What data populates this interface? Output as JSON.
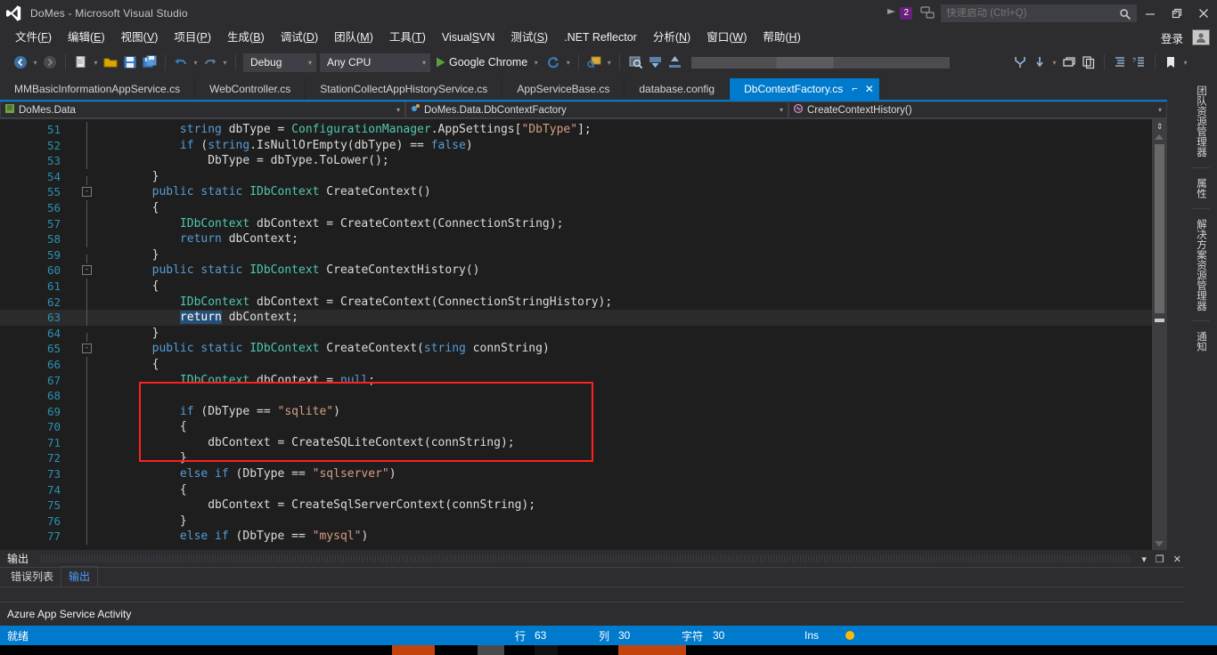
{
  "window": {
    "title": "DoMes - Microsoft Visual Studio",
    "logo_icon": "visual-studio-logo",
    "minimize_icon": "minimize-icon",
    "maximize_icon": "restore-icon",
    "close_icon": "close-icon",
    "notification_count": "2",
    "quick_launch_placeholder": "快速启动 (Ctrl+Q)",
    "quick_launch_value": "",
    "search_icon": "search-icon",
    "sign_in_label": "登录",
    "account_icon": "account-icon",
    "feedback_icon": "feedback-icon",
    "flag_icon": "flag-icon"
  },
  "menu": {
    "items": [
      {
        "pre": "文件(",
        "key": "F",
        "post": ")"
      },
      {
        "pre": "编辑(",
        "key": "E",
        "post": ")"
      },
      {
        "pre": "视图(",
        "key": "V",
        "post": ")"
      },
      {
        "pre": "项目(",
        "key": "P",
        "post": ")"
      },
      {
        "pre": "生成(",
        "key": "B",
        "post": ")"
      },
      {
        "pre": "调试(",
        "key": "D",
        "post": ")"
      },
      {
        "pre": "团队(",
        "key": "M",
        "post": ")"
      },
      {
        "pre": "工具(",
        "key": "T",
        "post": ")"
      },
      {
        "pre": "Visual",
        "key": "S",
        "post": "VN"
      },
      {
        "pre": "测试(",
        "key": "S",
        "post": ")"
      },
      {
        "pre": ".NET Reflector",
        "key": "",
        "post": ""
      },
      {
        "pre": "分析(",
        "key": "N",
        "post": ")"
      },
      {
        "pre": "窗口(",
        "key": "W",
        "post": ")"
      },
      {
        "pre": "帮助(",
        "key": "H",
        "post": ")"
      }
    ]
  },
  "toolbar": {
    "nav_back_icon": "navigate-back-icon",
    "nav_forward_icon": "navigate-forward-icon",
    "new_item_icon": "new-item-icon",
    "open_file_icon": "open-file-icon",
    "save_icon": "save-icon",
    "save_all_icon": "save-all-icon",
    "undo_icon": "undo-icon",
    "redo_icon": "redo-icon",
    "configuration": "Debug",
    "platform": "Any CPU",
    "start_icon": "start-play-icon",
    "start_target": "Google Chrome",
    "refresh_icon": "refresh-icon",
    "attach_icon": "attach-to-process-icon",
    "find_icon": "find-in-files-icon",
    "download_icon": "download-icon",
    "upload_icon": "upload-icon",
    "branch_icon": "branch-icon",
    "pull_icon": "pull-icon",
    "window_icon": "new-window-icon",
    "copy_icon": "copy-icon",
    "indent_icon": "indent-icon",
    "comment_icon": "comment-icon",
    "bookmark_icon": "bookmark-icon",
    "quote_icon": "quote-icon"
  },
  "tabs": {
    "items": [
      {
        "label": "MMBasicInformationAppService.cs",
        "active": false
      },
      {
        "label": "WebController.cs",
        "active": false
      },
      {
        "label": "StationCollectAppHistoryService.cs",
        "active": false
      },
      {
        "label": "AppServiceBase.cs",
        "active": false
      },
      {
        "label": "database.config",
        "active": false
      },
      {
        "label": "DbContextFactory.cs",
        "active": true
      }
    ],
    "pin_icon": "pin-icon",
    "close_icon": "close-tab-icon",
    "overflow_icon": "tab-overflow-icon"
  },
  "navbar": {
    "project": "DoMes.Data",
    "project_icon": "project-icon",
    "class": "DoMes.Data.DbContextFactory",
    "class_icon": "class-icon",
    "member": "CreateContextHistory()",
    "member_icon": "method-icon",
    "dropdown_icon": "chevron-down-icon"
  },
  "editor": {
    "current_line": 63,
    "selection": "return",
    "lines": [
      {
        "n": 51,
        "indent": 12,
        "fold": "",
        "vbar": "full",
        "tokens": [
          [
            "kw",
            "string"
          ],
          [
            "id",
            " dbType = "
          ],
          [
            "cls",
            "ConfigurationManager"
          ],
          [
            "id",
            ".AppSettings["
          ],
          [
            "str",
            "\"DbType\""
          ],
          [
            "id",
            "];"
          ]
        ]
      },
      {
        "n": 52,
        "indent": 12,
        "fold": "",
        "vbar": "full",
        "tokens": [
          [
            "kw",
            "if"
          ],
          [
            "id",
            " ("
          ],
          [
            "kw",
            "string"
          ],
          [
            "id",
            ".IsNullOrEmpty(dbType) == "
          ],
          [
            "kw",
            "false"
          ],
          [
            "id",
            ")"
          ]
        ]
      },
      {
        "n": 53,
        "indent": 16,
        "fold": "",
        "vbar": "full",
        "tokens": [
          [
            "id",
            "DbType = dbType.ToLower();"
          ]
        ]
      },
      {
        "n": 54,
        "indent": 8,
        "fold": "",
        "vbar": "half-top",
        "tokens": [
          [
            "id",
            "}"
          ]
        ]
      },
      {
        "n": 55,
        "indent": 8,
        "fold": "-",
        "vbar": "",
        "tokens": [
          [
            "kw",
            "public static"
          ],
          [
            "id",
            " "
          ],
          [
            "cls",
            "IDbContext"
          ],
          [
            "id",
            " CreateContext()"
          ]
        ]
      },
      {
        "n": 56,
        "indent": 8,
        "fold": "",
        "vbar": "full",
        "tokens": [
          [
            "id",
            "{"
          ]
        ]
      },
      {
        "n": 57,
        "indent": 12,
        "fold": "",
        "vbar": "full",
        "tokens": [
          [
            "cls",
            "IDbContext"
          ],
          [
            "id",
            " dbContext = CreateContext(ConnectionString);"
          ]
        ]
      },
      {
        "n": 58,
        "indent": 12,
        "fold": "",
        "vbar": "full",
        "tokens": [
          [
            "kw",
            "return"
          ],
          [
            "id",
            " dbContext;"
          ]
        ]
      },
      {
        "n": 59,
        "indent": 8,
        "fold": "",
        "vbar": "half-top",
        "tokens": [
          [
            "id",
            "}"
          ]
        ]
      },
      {
        "n": 60,
        "indent": 8,
        "fold": "-",
        "vbar": "",
        "tokens": [
          [
            "kw",
            "public static"
          ],
          [
            "id",
            " "
          ],
          [
            "cls",
            "IDbContext"
          ],
          [
            "id",
            " CreateContextHistory()"
          ]
        ]
      },
      {
        "n": 61,
        "indent": 8,
        "fold": "",
        "vbar": "full",
        "tokens": [
          [
            "id",
            "{"
          ]
        ]
      },
      {
        "n": 62,
        "indent": 12,
        "fold": "",
        "vbar": "full",
        "tokens": [
          [
            "cls",
            "IDbContext"
          ],
          [
            "id",
            " dbContext = CreateContext(ConnectionStringHistory);"
          ]
        ]
      },
      {
        "n": 63,
        "indent": 12,
        "fold": "",
        "vbar": "full",
        "current": true,
        "tokens": [
          [
            "sel",
            "return"
          ],
          [
            "id",
            " dbContext;"
          ]
        ]
      },
      {
        "n": 64,
        "indent": 8,
        "fold": "",
        "vbar": "half-top",
        "tokens": [
          [
            "id",
            "}"
          ]
        ]
      },
      {
        "n": 65,
        "indent": 8,
        "fold": "-",
        "vbar": "",
        "tokens": [
          [
            "kw",
            "public static"
          ],
          [
            "id",
            " "
          ],
          [
            "cls",
            "IDbContext"
          ],
          [
            "id",
            " CreateContext("
          ],
          [
            "kw",
            "string"
          ],
          [
            "id",
            " connString)"
          ]
        ]
      },
      {
        "n": 66,
        "indent": 8,
        "fold": "",
        "vbar": "full",
        "tokens": [
          [
            "id",
            "{"
          ]
        ]
      },
      {
        "n": 67,
        "indent": 12,
        "fold": "",
        "vbar": "full",
        "tokens": [
          [
            "cls",
            "IDbContext"
          ],
          [
            "id",
            " dbContext = "
          ],
          [
            "kw",
            "null"
          ],
          [
            "id",
            ";"
          ]
        ]
      },
      {
        "n": 68,
        "indent": 0,
        "fold": "",
        "vbar": "full",
        "tokens": []
      },
      {
        "n": 69,
        "indent": 12,
        "fold": "",
        "vbar": "full",
        "tokens": [
          [
            "kw",
            "if"
          ],
          [
            "id",
            " (DbType == "
          ],
          [
            "str",
            "\"sqlite\""
          ],
          [
            "id",
            ")"
          ]
        ]
      },
      {
        "n": 70,
        "indent": 12,
        "fold": "",
        "vbar": "full",
        "tokens": [
          [
            "id",
            "{"
          ]
        ]
      },
      {
        "n": 71,
        "indent": 16,
        "fold": "",
        "vbar": "full",
        "tokens": [
          [
            "id",
            "dbContext = CreateSQLiteContext(connString);"
          ]
        ]
      },
      {
        "n": 72,
        "indent": 12,
        "fold": "",
        "vbar": "full",
        "tokens": [
          [
            "id",
            "}"
          ]
        ]
      },
      {
        "n": 73,
        "indent": 12,
        "fold": "",
        "vbar": "full",
        "tokens": [
          [
            "kw",
            "else if"
          ],
          [
            "id",
            " (DbType == "
          ],
          [
            "str",
            "\"sqlserver\""
          ],
          [
            "id",
            ")"
          ]
        ]
      },
      {
        "n": 74,
        "indent": 12,
        "fold": "",
        "vbar": "full",
        "tokens": [
          [
            "id",
            "{"
          ]
        ]
      },
      {
        "n": 75,
        "indent": 16,
        "fold": "",
        "vbar": "full",
        "tokens": [
          [
            "id",
            "dbContext = CreateSqlServerContext(connString);"
          ]
        ]
      },
      {
        "n": 76,
        "indent": 12,
        "fold": "",
        "vbar": "full",
        "tokens": [
          [
            "id",
            "}"
          ]
        ]
      },
      {
        "n": 77,
        "indent": 12,
        "fold": "",
        "vbar": "full",
        "tokens": [
          [
            "kw",
            "else if"
          ],
          [
            "id",
            " (DbType == "
          ],
          [
            "str",
            "\"mysql\""
          ],
          [
            "id",
            ")"
          ]
        ]
      }
    ],
    "annotation": {
      "type": "red-rectangle",
      "color": "#ff2020",
      "from_line": 60,
      "to_line": 64
    }
  },
  "tool_tabs": {
    "items": [
      {
        "label": "团队资源管理器"
      },
      {
        "label": "属性"
      },
      {
        "label": "解决方案资源管理器"
      },
      {
        "label": "通知"
      }
    ]
  },
  "output": {
    "panel_title": "输出",
    "dropdown_icon": "chevron-down-icon",
    "undock_icon": "undock-icon",
    "close_icon": "close-panel-icon",
    "tabs": [
      {
        "label": "错误列表",
        "active": false
      },
      {
        "label": "输出",
        "active": true
      }
    ],
    "azure_label": "Azure App Service Activity"
  },
  "statusbar": {
    "state": "就绪",
    "line_label": "行",
    "line_value": "63",
    "col_label": "列",
    "col_value": "30",
    "char_label": "字符",
    "char_value": "30",
    "insert_mode": "Ins",
    "indicator_icon": "status-indicator-icon",
    "accent_color": "#007acc"
  },
  "taskbar": {
    "time": ""
  }
}
